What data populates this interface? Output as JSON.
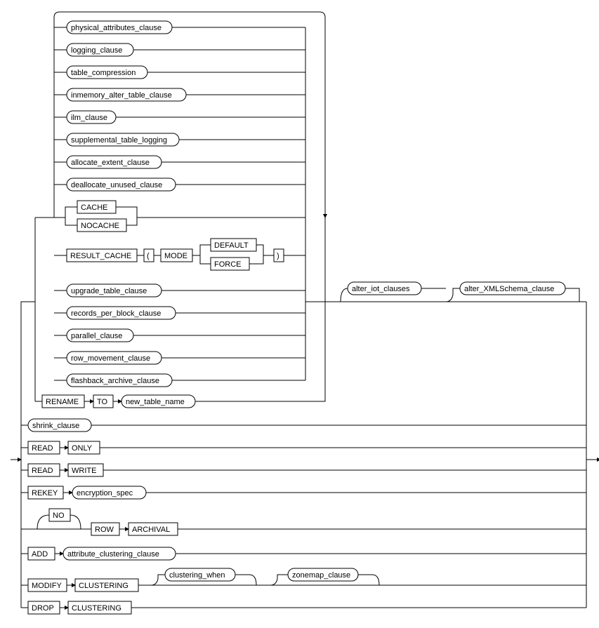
{
  "diagram": {
    "type": "syntax_railroad",
    "language": "SQL",
    "statement_fragment": "alter_table_properties",
    "terminals": {
      "cache": "CACHE",
      "nocache": "NOCACHE",
      "result_cache": "RESULT_CACHE",
      "lparen": "(",
      "rparen": ")",
      "mode": "MODE",
      "default": "DEFAULT",
      "force": "FORCE",
      "rename": "RENAME",
      "to": "TO",
      "read1": "READ",
      "only": "ONLY",
      "read2": "READ",
      "write": "WRITE",
      "rekey": "REKEY",
      "no": "NO",
      "row": "ROW",
      "archival": "ARCHIVAL",
      "add": "ADD",
      "modify": "MODIFY",
      "clustering1": "CLUSTERING",
      "drop": "DROP",
      "clustering2": "CLUSTERING"
    },
    "nonterminals": {
      "physical_attributes_clause": "physical_attributes_clause",
      "logging_clause": "logging_clause",
      "table_compression": "table_compression",
      "inmemory_alter_table_clause": "inmemory_alter_table_clause",
      "ilm_clause": "ilm_clause",
      "supplemental_table_logging": "supplemental_table_logging",
      "allocate_extent_clause": "allocate_extent_clause",
      "deallocate_unused_clause": "deallocate_unused_clause",
      "upgrade_table_clause": "upgrade_table_clause",
      "records_per_block_clause": "records_per_block_clause",
      "parallel_clause": "parallel_clause",
      "row_movement_clause": "row_movement_clause",
      "flashback_archive_clause": "flashback_archive_clause",
      "new_table_name": "new_table_name",
      "alter_iot_clauses": "alter_iot_clauses",
      "alter_xmlschema_clause": "alter_XMLSchema_clause",
      "shrink_clause": "shrink_clause",
      "encryption_spec": "encryption_spec",
      "attribute_clustering_clause": "attribute_clustering_clause",
      "clustering_when": "clustering_when",
      "zonemap_clause": "zonemap_clause"
    }
  },
  "chart_data": {
    "type": "railroad_syntax_diagram",
    "structure": {
      "main_alternatives": [
        {
          "branch": "repeatable_physical_group_then_optional_iot_xmlschema",
          "loop_min_one": [
            {
              "ref": "physical_attributes_clause"
            },
            {
              "ref": "logging_clause"
            },
            {
              "ref": "table_compression"
            },
            {
              "ref": "inmemory_alter_table_clause"
            },
            {
              "ref": "ilm_clause"
            },
            {
              "ref": "supplemental_table_logging"
            },
            {
              "ref": "allocate_extent_clause"
            },
            {
              "ref": "deallocate_unused_clause"
            },
            {
              "alt": [
                "CACHE",
                "NOCACHE"
              ]
            },
            {
              "seq": [
                "RESULT_CACHE",
                "(",
                "MODE",
                {
                  "alt": [
                    "DEFAULT",
                    "FORCE"
                  ]
                },
                ")"
              ]
            },
            {
              "ref": "upgrade_table_clause"
            },
            {
              "ref": "records_per_block_clause"
            },
            {
              "ref": "parallel_clause"
            },
            {
              "ref": "row_movement_clause"
            },
            {
              "ref": "flashback_archive_clause"
            }
          ],
          "then_optional": [
            {
              "ref": "alter_iot_clauses"
            },
            {
              "ref": "alter_XMLSchema_clause"
            }
          ]
        },
        {
          "seq": [
            "RENAME",
            "TO",
            {
              "ref": "new_table_name"
            }
          ]
        },
        {
          "ref": "shrink_clause"
        },
        {
          "seq": [
            "READ",
            "ONLY"
          ]
        },
        {
          "seq": [
            "READ",
            "WRITE"
          ]
        },
        {
          "seq": [
            "REKEY",
            {
              "ref": "encryption_spec"
            }
          ]
        },
        {
          "seq": [
            {
              "opt": "NO"
            },
            "ROW",
            "ARCHIVAL"
          ]
        },
        {
          "seq": [
            "ADD",
            {
              "ref": "attribute_clustering_clause"
            }
          ]
        },
        {
          "seq": [
            "MODIFY",
            "CLUSTERING",
            {
              "opt": {
                "ref": "clustering_when"
              }
            },
            {
              "opt": {
                "ref": "zonemap_clause"
              }
            }
          ]
        },
        {
          "seq": [
            "DROP",
            "CLUSTERING"
          ]
        }
      ]
    }
  }
}
